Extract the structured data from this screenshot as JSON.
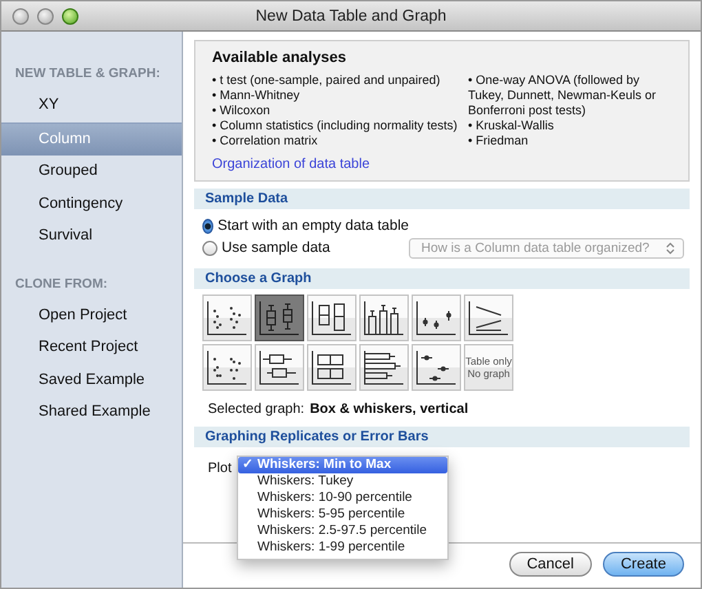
{
  "window": {
    "title": "New Data Table and Graph"
  },
  "sidebar": {
    "items": [
      {
        "kind": "header",
        "label": "NEW TABLE & GRAPH:"
      },
      {
        "kind": "item",
        "label": "XY",
        "selected": false
      },
      {
        "kind": "item",
        "label": "Column",
        "selected": true
      },
      {
        "kind": "item",
        "label": "Grouped",
        "selected": false
      },
      {
        "kind": "item",
        "label": "Contingency",
        "selected": false
      },
      {
        "kind": "item",
        "label": "Survival",
        "selected": false
      },
      {
        "kind": "header",
        "label": "CLONE FROM:"
      },
      {
        "kind": "item",
        "label": "Open Project",
        "selected": false
      },
      {
        "kind": "item",
        "label": "Recent Project",
        "selected": false
      },
      {
        "kind": "item",
        "label": "Saved Example",
        "selected": false
      },
      {
        "kind": "item",
        "label": "Shared Example",
        "selected": false
      }
    ]
  },
  "analyses": {
    "title": "Available analyses",
    "columns": [
      [
        "• t test (one-sample, paired and unpaired)",
        "• Mann-Whitney",
        "• Wilcoxon",
        "• Column statistics (including normality tests)",
        "• Correlation matrix"
      ],
      [
        "• One-way ANOVA (followed by Tukey, Dunnett, Newman-Keuls or Bonferroni post tests)",
        "• Kruskal-Wallis",
        "• Friedman"
      ]
    ],
    "link": "Organization of data table"
  },
  "sample_data": {
    "title": "Sample Data",
    "options": [
      {
        "label": "Start with an empty data table",
        "selected": true
      },
      {
        "label": "Use sample data",
        "selected": false
      }
    ],
    "sample_select": {
      "value": "How is a Column data table organized?",
      "disabled": true
    }
  },
  "graph": {
    "title": "Choose a Graph",
    "options": [
      {
        "kind": "scatter",
        "selected": false
      },
      {
        "kind": "box",
        "selected": true
      },
      {
        "kind": "floating",
        "selected": false
      },
      {
        "kind": "bars",
        "selected": false
      },
      {
        "kind": "points",
        "selected": false
      },
      {
        "kind": "before-after",
        "selected": false
      },
      {
        "kind": "scatter-dense",
        "selected": false
      },
      {
        "kind": "box-h",
        "selected": false
      },
      {
        "kind": "floating-h",
        "selected": false
      },
      {
        "kind": "bars-h",
        "selected": false
      },
      {
        "kind": "points-h",
        "selected": false
      },
      {
        "kind": "text",
        "label": "Table only No graph",
        "selected": false
      }
    ],
    "selected_label": "Selected graph:",
    "selected_value": "Box & whiskers, vertical"
  },
  "replicates": {
    "title": "Graphing Replicates or Error Bars",
    "plot_label": "Plot",
    "menu": [
      {
        "label": "Whiskers: Min to Max",
        "selected": true
      },
      {
        "label": "Whiskers: Tukey",
        "selected": false
      },
      {
        "label": "Whiskers: 10-90 percentile",
        "selected": false
      },
      {
        "label": "Whiskers: 5-95 percentile",
        "selected": false
      },
      {
        "label": "Whiskers: 2.5-97.5 percentile",
        "selected": false
      },
      {
        "label": "Whiskers: 1-99 percentile",
        "selected": false
      }
    ],
    "check": "✓"
  },
  "buttons": [
    {
      "label": "Cancel",
      "default": false
    },
    {
      "label": "Create",
      "default": true
    }
  ]
}
